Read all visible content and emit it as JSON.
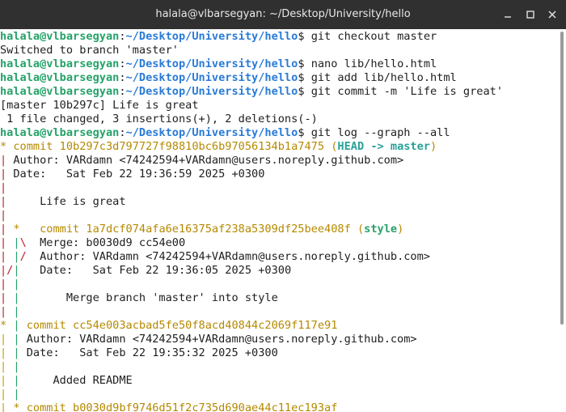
{
  "window": {
    "title": "halala@vlbarsegyan: ~/Desktop/University/hello",
    "minimize_icon": "minimize-icon",
    "maximize_icon": "maximize-icon",
    "close_icon": "close-icon"
  },
  "prompt": {
    "user": "halala@vlbarsegyan",
    "sep": ":",
    "path": "~/Desktop/University/hello",
    "dollar": "$ "
  },
  "commands": {
    "c1": "git checkout master",
    "c2": "nano lib/hello.html",
    "c3": "git add lib/hello.html",
    "c4": "git commit -m 'Life is great'",
    "c5": "git log --graph --all"
  },
  "output": {
    "o1": "Switched to branch 'master'",
    "o2": "[master 10b297c] Life is great",
    "o3": " 1 file changed, 3 insertions(+), 2 deletions(-)"
  },
  "log": {
    "c1_hash": "commit 10b297c3d797727f98810bc6b97056134b1a7475",
    "c1_head": "HEAD -> master",
    "c1_author": "Author: VARdamn <74242594+VARdamn@users.noreply.github.com>",
    "c1_date": "Date:   Sat Feb 22 19:36:59 2025 +0300",
    "c1_msg": "Life is great",
    "c2_hash": "commit 1a7dcf074afa6e16375af238a5309df25bee408f",
    "c2_ref": "style",
    "c2_merge": "Merge: b0030d9 cc54e00",
    "c2_author": "Author: VARdamn <74242594+VARdamn@users.noreply.github.com>",
    "c2_date": "Date:   Sat Feb 22 19:36:05 2025 +0300",
    "c2_msg": "Merge branch 'master' into style",
    "c3_hash": "commit cc54e003acbad5fe50f8acd40844c2069f117e91",
    "c3_author": "Author: VARdamn <74242594+VARdamn@users.noreply.github.com>",
    "c3_date": "Date:   Sat Feb 22 19:35:32 2025 +0300",
    "c3_msg": "Added README",
    "c4_hash": "commit b0030d9bf9746d51f2c735d690ae44c11ec193af"
  },
  "colors": {
    "user": "#26a269",
    "path": "#2a7bd6",
    "hash": "#b58900",
    "head": "#2aa198",
    "graph_red": "#c01c28",
    "graph_green": "#26a269",
    "graph_yellow": "#c4a000"
  }
}
